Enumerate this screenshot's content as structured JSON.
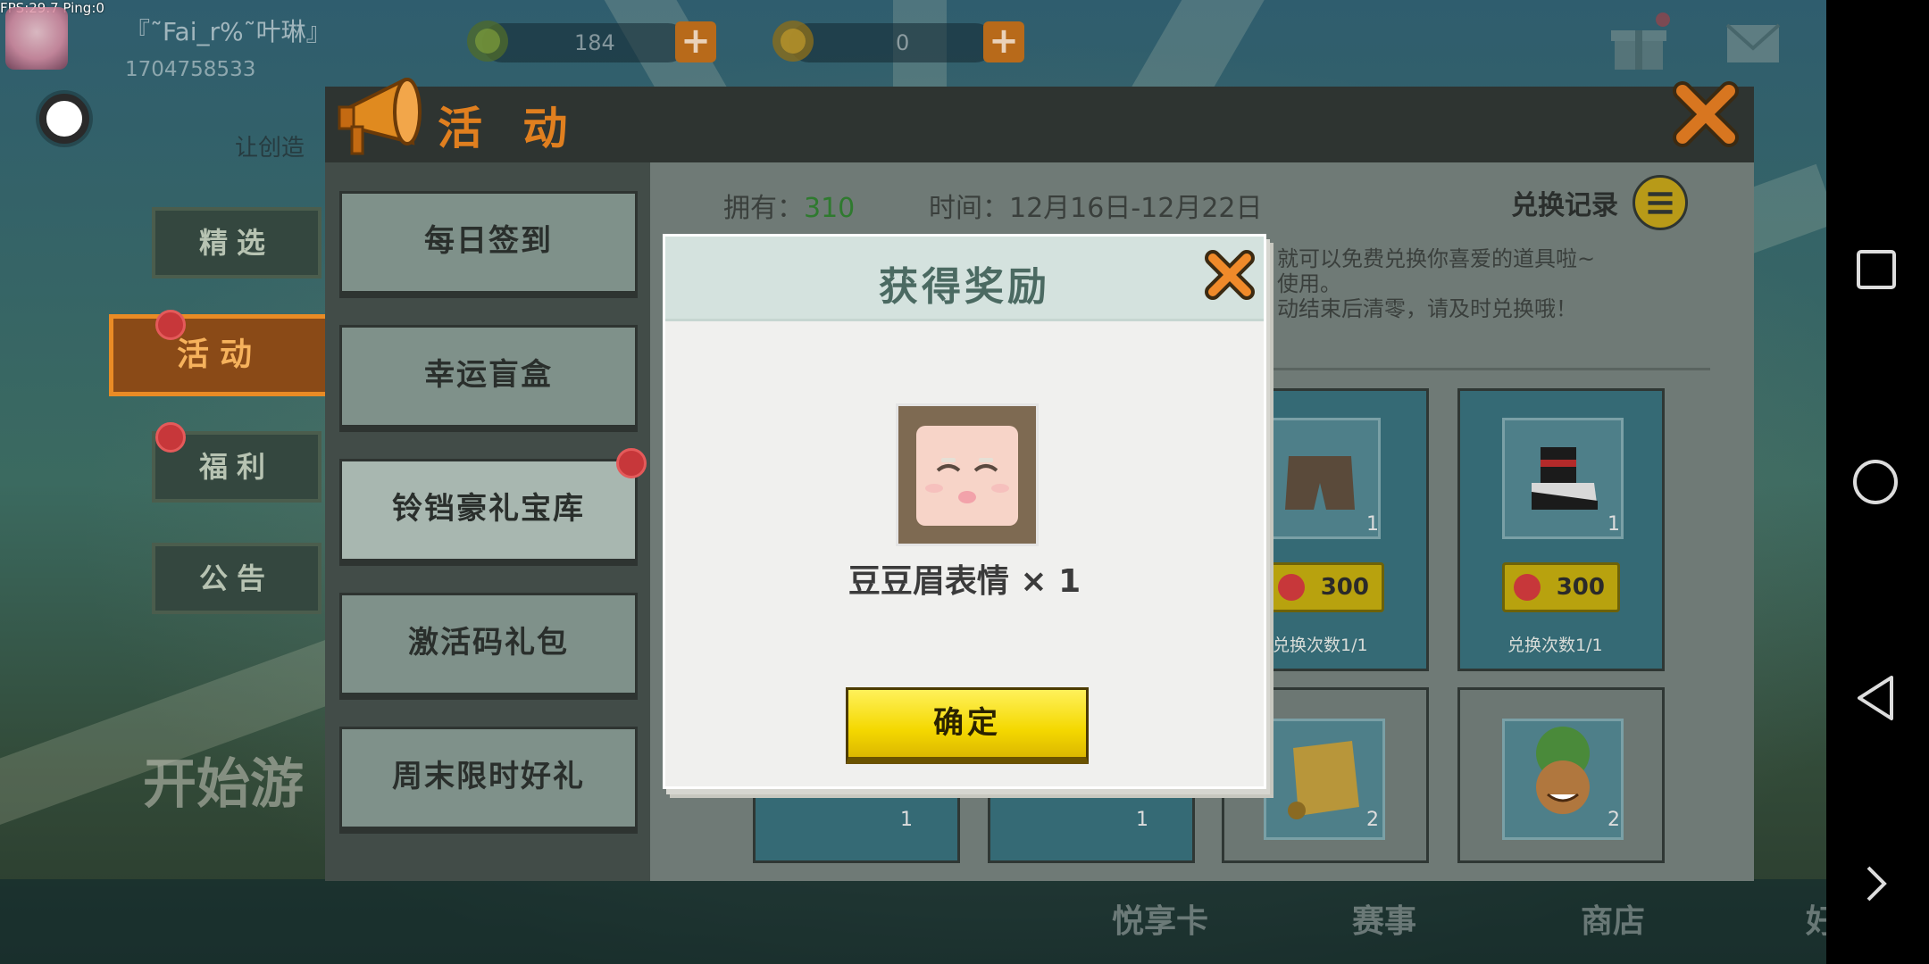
{
  "status_overlay": "FPS:29.7  Ping:0",
  "player": {
    "name": "『˜Fai_r%˜叶琳』",
    "id": "1704758533"
  },
  "currencies": [
    {
      "icon": "green-gem-icon",
      "value": "184"
    },
    {
      "icon": "gold-coin-icon",
      "value": "0"
    }
  ],
  "tagline": "让创造",
  "left_tabs": {
    "featured": "精选",
    "activity": "活动",
    "welfare": "福利",
    "notice": "公告"
  },
  "start_game": "开始游",
  "bottom_nav": {
    "pass_card": "悦享卡",
    "events": "赛事",
    "shop": "商店",
    "friends": "好友"
  },
  "panel": {
    "title": "活 动",
    "menu": [
      "每日签到",
      "幸运盲盒",
      "铃铛豪礼宝库",
      "激活码礼包",
      "周末限时好礼"
    ],
    "owned_label": "拥有：",
    "owned_value": "310",
    "time_label": "时间：12月16日-12月22日",
    "exchange_record": "兑换记录",
    "description": [
      "就可以免费兑换你喜爱的道具啦~",
      "使用。",
      "动结束后清零，请及时兑换哦！"
    ]
  },
  "cards": [
    {
      "price": "300",
      "count": "1",
      "limit": "兑换次数1/1"
    },
    {
      "price": "300",
      "count": "1",
      "limit": "兑换次数1/1"
    },
    {
      "count": "1"
    },
    {
      "count": "1"
    },
    {
      "count": "2"
    },
    {
      "count": "2"
    }
  ],
  "dialog": {
    "title": "获得奖励",
    "item_name": "豆豆眉表情 × 1",
    "confirm": "确定"
  },
  "colors": {
    "accent_orange": "#e07f1f",
    "confirm_yellow": "#f4d800",
    "panel_dark": "#2e3431"
  }
}
